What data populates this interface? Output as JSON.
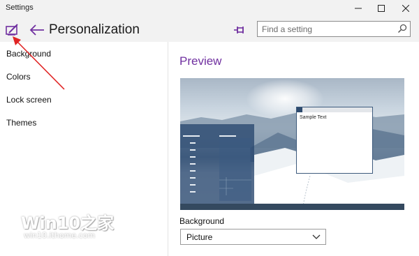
{
  "window": {
    "title": "Settings",
    "controls": [
      "minimize-icon",
      "maximize-icon",
      "close-icon"
    ]
  },
  "header": {
    "page_title": "Personalization",
    "search": {
      "placeholder": "Find a setting",
      "value": ""
    },
    "icons": [
      "settings-brush-icon",
      "back-arrow-icon",
      "pin-icon",
      "search-icon"
    ]
  },
  "sidebar": {
    "items": [
      {
        "label": "Background"
      },
      {
        "label": "Colors"
      },
      {
        "label": "Lock screen"
      },
      {
        "label": "Themes"
      }
    ]
  },
  "main": {
    "preview_heading": "Preview",
    "sample_text": "Sample Text",
    "background_label": "Background",
    "background_value": "Picture"
  },
  "watermark": {
    "brand": "Win10之家",
    "url": "win10.ithome.com"
  },
  "colors": {
    "accent": "#7030a0",
    "annotation_arrow": "#e02424",
    "preview_accent": "#2d4a6e"
  }
}
